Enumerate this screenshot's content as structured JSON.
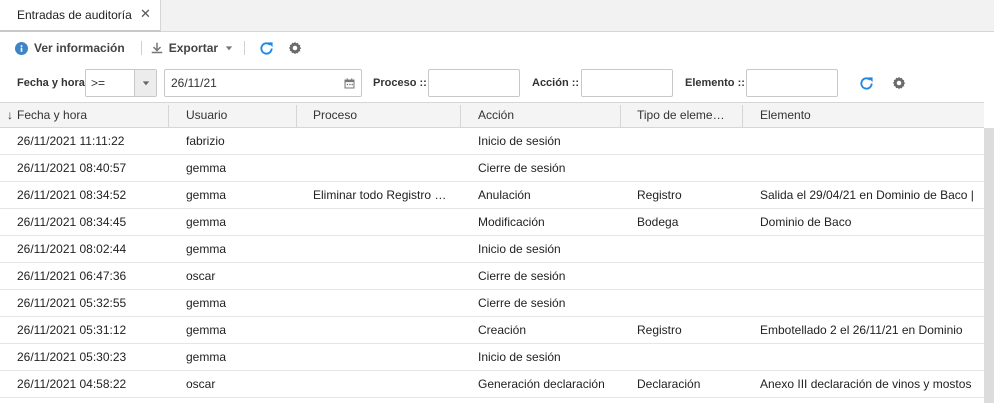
{
  "tab": {
    "label": "Entradas de auditoría",
    "close": "✕"
  },
  "toolbar": {
    "ver_informacion": "Ver información",
    "exportar": "Exportar"
  },
  "filters": {
    "fecha_label": "Fecha y hora",
    "operator": ">=",
    "date_value": "26/11/21",
    "proceso_label": "Proceso ::",
    "accion_label": "Acción ::",
    "elemento_label": "Elemento ::"
  },
  "columns": [
    "Fecha y hora",
    "Usuario",
    "Proceso",
    "Acción",
    "Tipo de eleme…",
    "Elemento"
  ],
  "sort_indicator": "↓",
  "rows": [
    [
      "26/11/2021 11:11:22",
      "fabrizio",
      "",
      "Inicio de sesión",
      "",
      ""
    ],
    [
      "26/11/2021 08:40:57",
      "gemma",
      "",
      "Cierre de sesión",
      "",
      ""
    ],
    [
      "26/11/2021 08:34:52",
      "gemma",
      "Eliminar todo Registro …",
      "Anulación",
      "Registro",
      "Salida el 29/04/21 en Dominio de Baco |"
    ],
    [
      "26/11/2021 08:34:45",
      "gemma",
      "",
      "Modificación",
      "Bodega",
      "Dominio de Baco"
    ],
    [
      "26/11/2021 08:02:44",
      "gemma",
      "",
      "Inicio de sesión",
      "",
      ""
    ],
    [
      "26/11/2021 06:47:36",
      "oscar",
      "",
      "Cierre de sesión",
      "",
      ""
    ],
    [
      "26/11/2021 05:32:55",
      "gemma",
      "",
      "Cierre de sesión",
      "",
      ""
    ],
    [
      "26/11/2021 05:31:12",
      "gemma",
      "",
      "Creación",
      "Registro",
      "Embotellado 2 el 26/11/21 en Dominio"
    ],
    [
      "26/11/2021 05:30:23",
      "gemma",
      "",
      "Inicio de sesión",
      "",
      ""
    ],
    [
      "26/11/2021 04:58:22",
      "oscar",
      "",
      "Generación declaración",
      "Declaración",
      "Anexo III declaración de vinos y mostos"
    ]
  ],
  "colors": {
    "accent": "#1e88e5",
    "icon_gray": "#666666"
  }
}
